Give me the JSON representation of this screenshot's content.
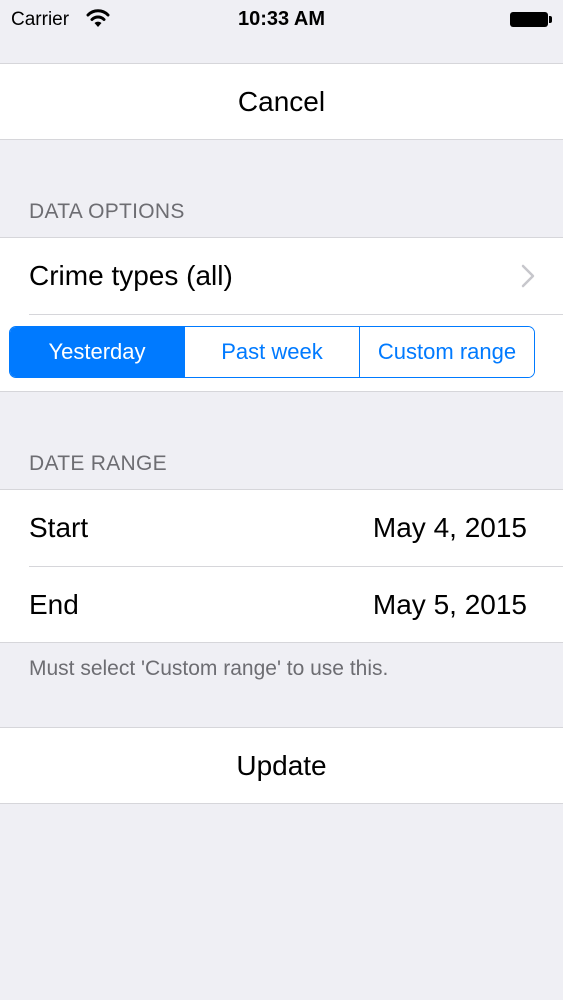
{
  "status_bar": {
    "carrier": "Carrier",
    "time": "10:33 AM",
    "wifi_icon": "wifi-icon",
    "battery_icon": "battery-icon"
  },
  "cancel_label": "Cancel",
  "data_options": {
    "header": "DATA OPTIONS",
    "crime_types_label": "Crime types (all)",
    "chevron_icon": "chevron-right-icon",
    "segments": [
      "Yesterday",
      "Past week",
      "Custom range"
    ],
    "selected_segment": "Yesterday"
  },
  "date_range": {
    "header": "DATE RANGE",
    "start_label": "Start",
    "start_value": "May 4, 2015",
    "end_label": "End",
    "end_value": "May 5, 2015",
    "footer": "Must select 'Custom range' to use this."
  },
  "update_label": "Update",
  "colors": {
    "accent": "#007aff",
    "background": "#efeff4",
    "secondary_text": "#6d6d72"
  }
}
